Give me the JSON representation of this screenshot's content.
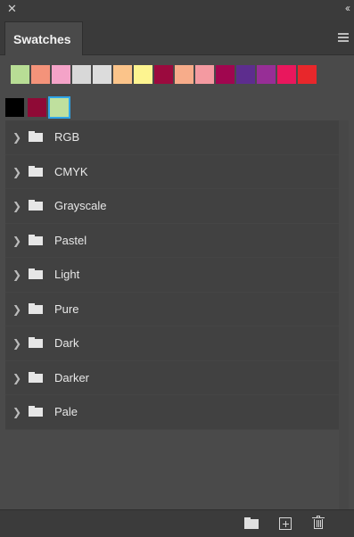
{
  "panel": {
    "close_glyph": "✕",
    "collapse_glyph": "‹‹",
    "tab_label": "Swatches"
  },
  "recent_swatches": [
    "#b8dd95",
    "#f4937a",
    "#f4a3c8",
    "#d8d8d8",
    "#dcdcdc",
    "#fbc48a",
    "#fdf490",
    "#9b0a3e",
    "#f7ac8a",
    "#f49aa1",
    "#a0064f",
    "#5d2d8e",
    "#972e96",
    "#e9175d",
    "#e8272b"
  ],
  "main_swatches": [
    {
      "color": "#000000",
      "selected": false
    },
    {
      "color": "#8f0a36",
      "selected": false
    },
    {
      "color": "#bfe09e",
      "selected": true
    }
  ],
  "groups": [
    {
      "label": "RGB"
    },
    {
      "label": "CMYK"
    },
    {
      "label": "Grayscale"
    },
    {
      "label": "Pastel"
    },
    {
      "label": "Light"
    },
    {
      "label": "Pure"
    },
    {
      "label": "Dark"
    },
    {
      "label": "Darker"
    },
    {
      "label": "Pale"
    }
  ],
  "icons": {
    "chevron": "❯"
  }
}
